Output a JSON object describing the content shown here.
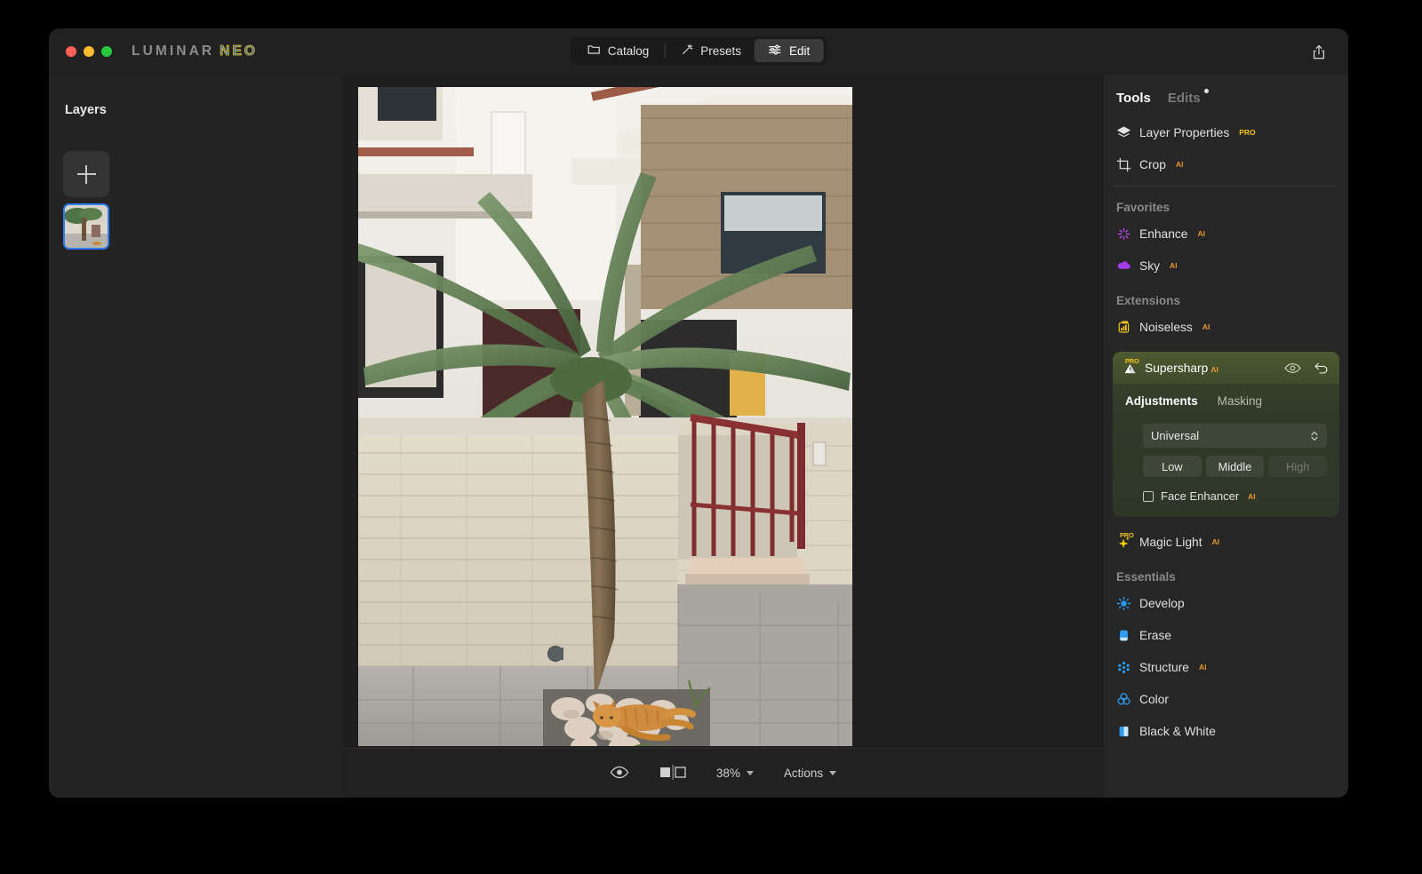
{
  "window": {
    "brand_first": "LUMINAR",
    "brand_second": "NEO",
    "traffic_lights": [
      "close",
      "minimize",
      "zoom"
    ]
  },
  "topbar": {
    "tabs": [
      {
        "label": "Catalog",
        "icon": "folder-icon",
        "active": false
      },
      {
        "label": "Presets",
        "icon": "magic-wand-icon",
        "active": false
      },
      {
        "label": "Edit",
        "icon": "sliders-icon",
        "active": true
      }
    ],
    "share_icon": "share-icon"
  },
  "layers": {
    "title": "Layers",
    "add_button_icon": "plus-icon",
    "thumbnail_selected": true,
    "selection_color": "#2f7bf6"
  },
  "bottom_bar": {
    "eye_icon": "eye-icon",
    "compare_icon": "before-after-icon",
    "zoom_level": "38%",
    "actions_label": "Actions"
  },
  "tools_panel": {
    "header": {
      "tools_label": "Tools",
      "edits_label": "Edits",
      "edits_has_dot": true
    },
    "top_tools": [
      {
        "label": "Layer Properties",
        "icon": "layers-icon",
        "badge": "PRO",
        "badge_type": "pro"
      },
      {
        "label": "Crop",
        "icon": "crop-icon",
        "badge": "AI",
        "badge_type": "ai"
      }
    ],
    "sections": [
      {
        "label": "Favorites",
        "items": [
          {
            "label": "Enhance",
            "icon": "enhance-sparkle-icon",
            "badge": "AI",
            "badge_type": "ai",
            "color": "#b44ce0"
          },
          {
            "label": "Sky",
            "icon": "cloud-icon",
            "badge": "AI",
            "badge_type": "ai",
            "color": "#a23ce8"
          }
        ]
      },
      {
        "label": "Extensions",
        "items": [
          {
            "label": "Noiseless",
            "icon": "noiseless-icon",
            "badge": "AI",
            "badge_type": "ai",
            "color": "#f0c419"
          }
        ]
      }
    ],
    "expanded_tool": {
      "name": "Supersharp",
      "pro_badge": "PRO",
      "ai_badge": "AI",
      "icon": "supersharp-triangle-icon",
      "visibility_icon": "eye-icon",
      "reset_icon": "undo-arrow-icon",
      "tabs": [
        {
          "label": "Adjustments",
          "active": true
        },
        {
          "label": "Masking",
          "active": false
        }
      ],
      "select_value": "Universal",
      "segments": [
        {
          "label": "Low",
          "disabled": false
        },
        {
          "label": "Middle",
          "disabled": false
        },
        {
          "label": "High",
          "disabled": true
        }
      ],
      "checkbox": {
        "label": "Face Enhancer",
        "badge": "AI",
        "checked": false
      }
    },
    "after_expanded": [
      {
        "label": "Magic Light",
        "icon": "magic-light-icon",
        "badge": "AI",
        "badge_type": "ai",
        "color": "#f5d000"
      }
    ],
    "essentials": {
      "label": "Essentials",
      "items": [
        {
          "label": "Develop",
          "icon": "sun-icon",
          "badge": "",
          "badge_type": "",
          "color": "#2d9bf0"
        },
        {
          "label": "Erase",
          "icon": "eraser-icon",
          "badge": "",
          "badge_type": "",
          "color": "#2d9bf0"
        },
        {
          "label": "Structure",
          "icon": "structure-icon",
          "badge": "AI",
          "badge_type": "ai",
          "color": "#2d9bf0"
        },
        {
          "label": "Color",
          "icon": "color-rings-icon",
          "badge": "",
          "badge_type": "",
          "color": "#2d9bf0"
        },
        {
          "label": "Black & White",
          "icon": "bw-icon",
          "badge": "",
          "badge_type": "",
          "color": "#2d9bf0"
        }
      ]
    }
  },
  "photo": {
    "description": "Palm tree beside a stone-clad wall with an orange tabby cat lying on the paving stones and a dark red metal gate"
  }
}
